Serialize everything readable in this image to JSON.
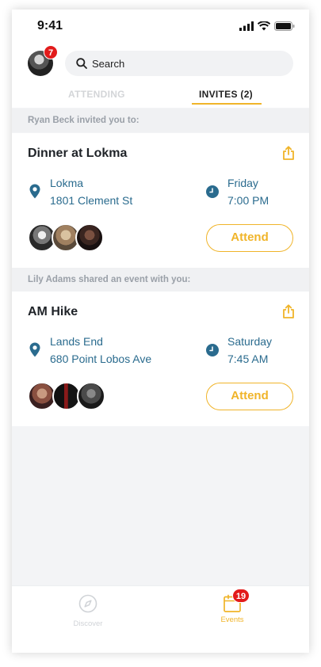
{
  "status_bar": {
    "time": "9:41"
  },
  "header": {
    "avatar_badge": "7",
    "search": {
      "placeholder": "Search"
    },
    "tabs": [
      {
        "label": "ATTENDING",
        "active": false
      },
      {
        "label": "INVITES (2)",
        "active": true
      }
    ]
  },
  "feed": [
    {
      "label": "Ryan Beck invited you to:",
      "event": {
        "title": "Dinner at Lokma",
        "venue": "Lokma",
        "address": "1801 Clement St",
        "day": "Friday",
        "time": "7:00 PM",
        "attend_label": "Attend"
      }
    },
    {
      "label": "Lily Adams shared an event with you:",
      "event": {
        "title": "AM Hike",
        "venue": "Lands End",
        "address": "680 Point Lobos Ave",
        "day": "Saturday",
        "time": "7:45 AM",
        "attend_label": "Attend"
      }
    }
  ],
  "bottom_nav": {
    "items": [
      {
        "label": "Discover",
        "icon": "compass-icon",
        "active": false
      },
      {
        "label": "Events",
        "icon": "calendar-icon",
        "active": true,
        "badge": "19"
      }
    ]
  },
  "colors": {
    "accent": "#f0b429",
    "link": "#2a6b8e",
    "badge": "#e21b1b"
  }
}
